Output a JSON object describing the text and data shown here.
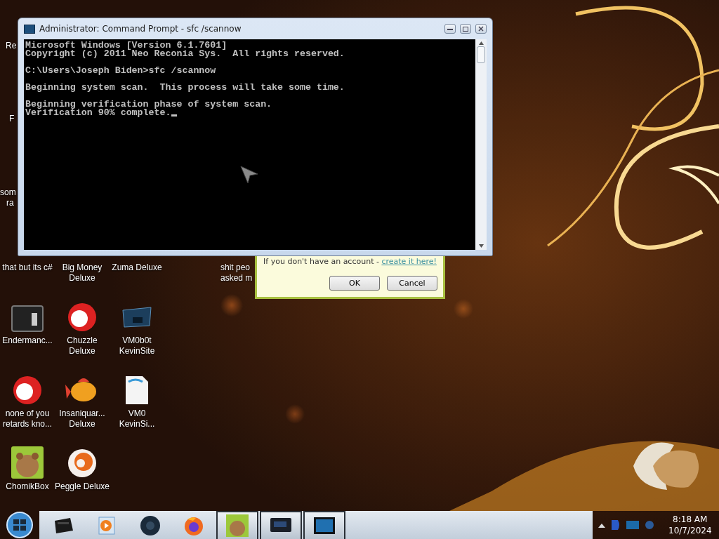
{
  "console_window": {
    "title": "Administrator: Command Prompt - sfc  /scannow",
    "paragraphs": [
      [
        "Microsoft Windows [Version 6.1.7601]",
        "Copyright (c) 2011 Neo Reconia Sys.  All rights reserved."
      ],
      [
        "C:\\Users\\Joseph Biden>sfc /scannow"
      ],
      [
        "Beginning system scan.  This process will take some time."
      ],
      [
        "Beginning verification phase of system scan.",
        "Verification 90% complete."
      ]
    ],
    "cursor_visible": true
  },
  "partial_labels": [
    "Re",
    "F",
    "som",
    "ra"
  ],
  "desktop_icons": [
    {
      "kind": "none",
      "lines": [
        "that but its c#"
      ]
    },
    {
      "kind": "none",
      "lines": [
        "Big Money",
        "Deluxe"
      ]
    },
    {
      "kind": "none",
      "lines": [
        "Zuma Deluxe"
      ]
    },
    {
      "kind": "gap"
    },
    {
      "kind": "none",
      "lines": [
        "shit peo",
        "asked m"
      ]
    },
    {
      "kind": "terminal",
      "lines": [
        "Endermanc..."
      ]
    },
    {
      "kind": "ball",
      "lines": [
        "Chuzzle",
        "Deluxe"
      ]
    },
    {
      "kind": "monitor",
      "lines": [
        "VM0b0t",
        "KevinSite"
      ]
    },
    {
      "kind": "gap"
    },
    {
      "kind": "gap"
    },
    {
      "kind": "ball",
      "lines": [
        "none of you",
        "retards kno..."
      ]
    },
    {
      "kind": "fish",
      "lines": [
        "Insaniquar...",
        "Deluxe"
      ]
    },
    {
      "kind": "document",
      "lines": [
        "VM0",
        "KevinSi..."
      ]
    },
    {
      "kind": "gap"
    },
    {
      "kind": "gap"
    },
    {
      "kind": "hamster",
      "lines": [
        "ChomikBox"
      ]
    },
    {
      "kind": "swirl-ball",
      "lines": [
        "Peggle Deluxe"
      ]
    }
  ],
  "dialog": {
    "message": "If you don't have an account - ",
    "link": "create it here!",
    "buttons": [
      "OK",
      "Cancel"
    ]
  },
  "taskbar": {
    "buttons": [
      {
        "kind": "printer",
        "active": false
      },
      {
        "kind": "player",
        "active": false
      },
      {
        "kind": "orb",
        "active": false
      },
      {
        "kind": "browser",
        "active": false
      },
      {
        "kind": "hamster",
        "active": true
      },
      {
        "kind": "monitor",
        "active": true
      },
      {
        "kind": "screen",
        "active": true
      }
    ],
    "time": "8:18 AM",
    "date": "10/7/2024"
  }
}
